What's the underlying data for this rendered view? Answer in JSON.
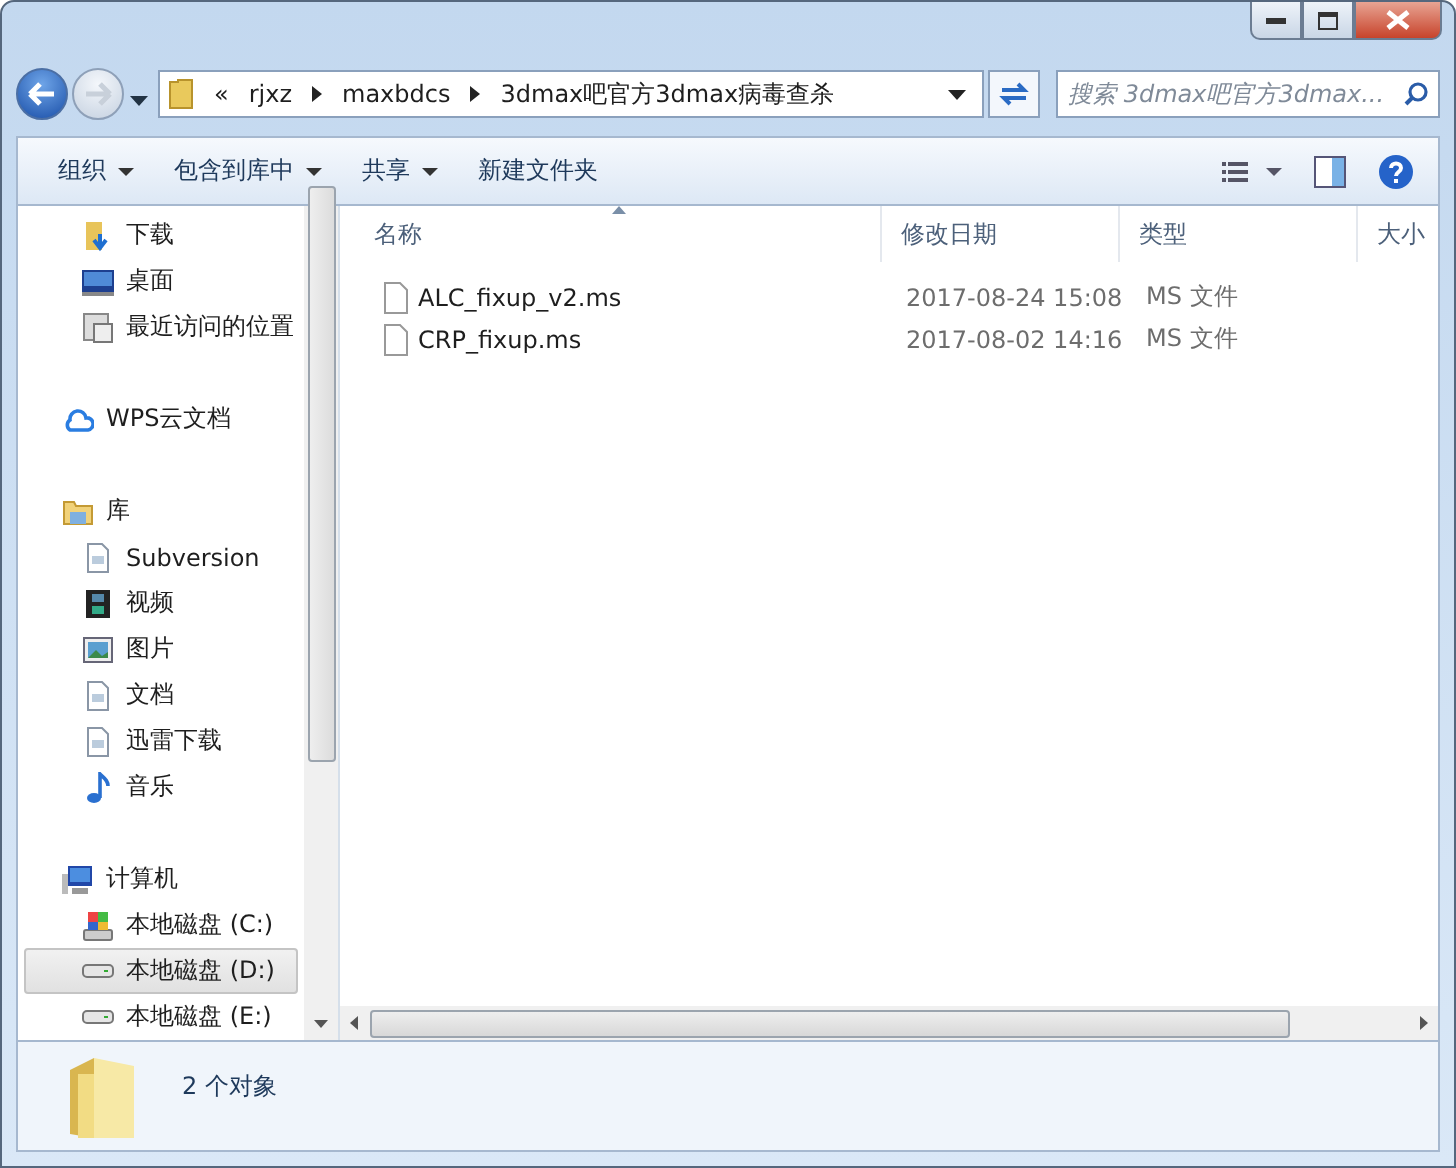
{
  "address_bar": {
    "overflow": "«",
    "crumbs": [
      "rjxz",
      "maxbdcs",
      "3dmax吧官方3dmax病毒查杀"
    ]
  },
  "search": {
    "placeholder": "搜索 3dmax吧官方3dmax..."
  },
  "toolbar": {
    "buttons": [
      {
        "label": "组织",
        "dropdown": true
      },
      {
        "label": "包含到库中",
        "dropdown": true
      },
      {
        "label": "共享",
        "dropdown": true
      },
      {
        "label": "新建文件夹",
        "dropdown": false
      }
    ]
  },
  "sidebar": {
    "sections": [
      {
        "items": [
          {
            "label": "下载",
            "selected": false
          },
          {
            "label": "桌面",
            "selected": false
          },
          {
            "label": "最近访问的位置",
            "selected": false
          }
        ]
      },
      {
        "header": "WPS云文档"
      },
      {
        "header": "库",
        "items": [
          {
            "label": "Subversion",
            "selected": false
          },
          {
            "label": "视频",
            "selected": false
          },
          {
            "label": "图片",
            "selected": false
          },
          {
            "label": "文档",
            "selected": false
          },
          {
            "label": "迅雷下载",
            "selected": false
          },
          {
            "label": "音乐",
            "selected": false
          }
        ]
      },
      {
        "header": "计算机",
        "items": [
          {
            "label": "本地磁盘 (C:)",
            "selected": false
          },
          {
            "label": "本地磁盘 (D:)",
            "selected": true
          },
          {
            "label": "本地磁盘 (E:)",
            "selected": false
          }
        ]
      }
    ]
  },
  "table": {
    "columns": [
      "名称",
      "修改日期",
      "类型",
      "大小"
    ],
    "rows": [
      {
        "name": "ALC_fixup_v2.ms",
        "modified": "2017-08-24 15:08",
        "type": "MS 文件"
      },
      {
        "name": "CRP_fixup.ms",
        "modified": "2017-08-02 14:16",
        "type": "MS 文件"
      }
    ]
  },
  "status_bar": {
    "count": "2 个对象"
  }
}
